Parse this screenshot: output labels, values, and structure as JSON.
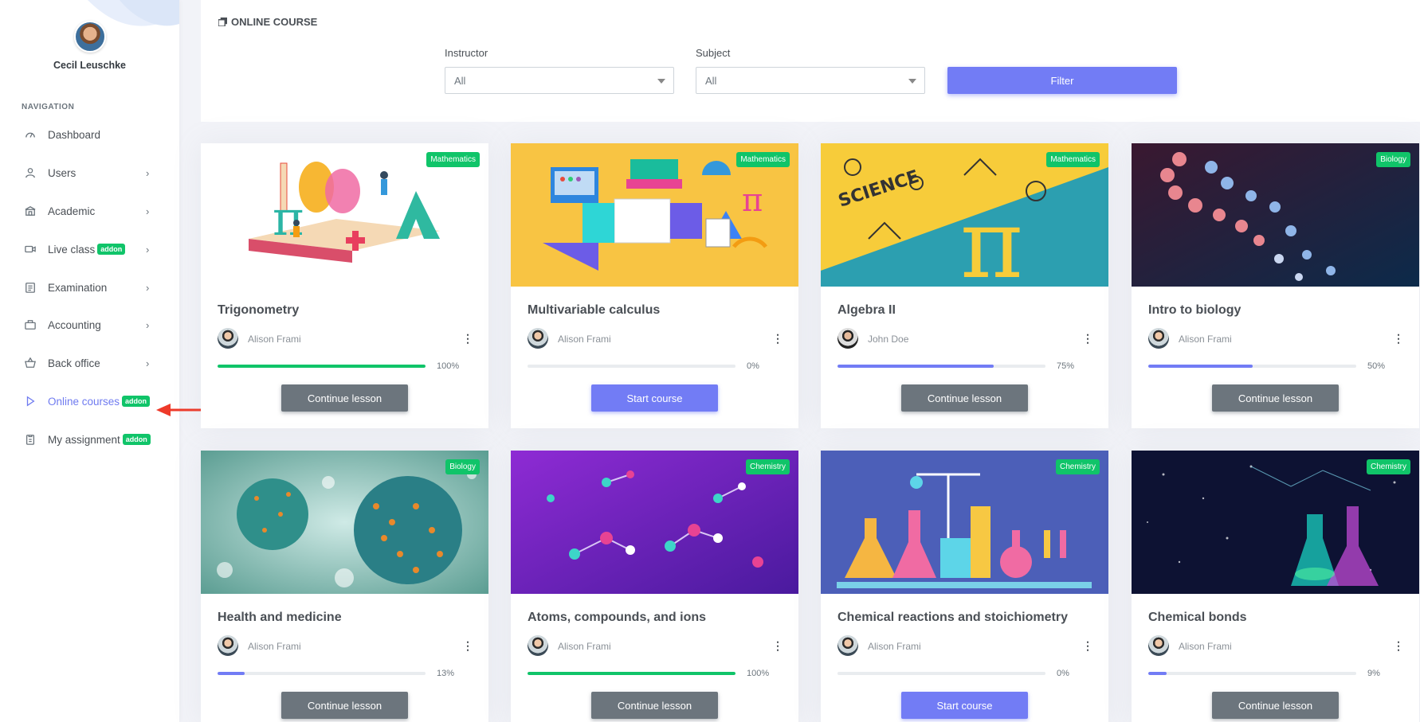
{
  "profile": {
    "name": "Cecil Leuschke"
  },
  "nav": {
    "title": "NAVIGATION",
    "items": [
      {
        "label": "Dashboard",
        "icon": "dashboard-gauge-icon",
        "chevron": false,
        "addon": ""
      },
      {
        "label": "Users",
        "icon": "user-icon",
        "chevron": true,
        "addon": ""
      },
      {
        "label": "Academic",
        "icon": "school-icon",
        "chevron": true,
        "addon": ""
      },
      {
        "label": "Live class",
        "icon": "video-icon",
        "chevron": true,
        "addon": "addon"
      },
      {
        "label": "Examination",
        "icon": "clipboard-icon",
        "chevron": true,
        "addon": ""
      },
      {
        "label": "Accounting",
        "icon": "briefcase-icon",
        "chevron": true,
        "addon": ""
      },
      {
        "label": "Back office",
        "icon": "basket-icon",
        "chevron": true,
        "addon": ""
      },
      {
        "label": "Online courses",
        "icon": "play-icon",
        "chevron": false,
        "addon": "addon",
        "active": true
      },
      {
        "label": "My assignment",
        "icon": "assignment-icon",
        "chevron": false,
        "addon": "addon"
      }
    ]
  },
  "header": {
    "title": "ONLINE COURSE",
    "instructor_label": "Instructor",
    "instructor_value": "All",
    "subject_label": "Subject",
    "subject_value": "All",
    "filter_label": "Filter"
  },
  "colors": {
    "accent": "#727cf5",
    "success": "#10c469",
    "secondary": "#6c757d"
  },
  "courses": [
    {
      "title": "Trigonometry",
      "category": "Mathematics",
      "instructor": "Alison Frami",
      "progress": 100,
      "progress_label": "100%",
      "action": "Continue lesson",
      "action_type": "continue",
      "bar_color": "#10c469"
    },
    {
      "title": "Multivariable calculus",
      "category": "Mathematics",
      "instructor": "Alison Frami",
      "progress": 0,
      "progress_label": "0%",
      "action": "Start course",
      "action_type": "start",
      "bar_color": "#727cf5"
    },
    {
      "title": "Algebra II",
      "category": "Mathematics",
      "instructor": "John Doe",
      "progress": 75,
      "progress_label": "75%",
      "action": "Continue lesson",
      "action_type": "continue",
      "bar_color": "#727cf5"
    },
    {
      "title": "Intro to biology",
      "category": "Biology",
      "instructor": "Alison Frami",
      "progress": 50,
      "progress_label": "50%",
      "action": "Continue lesson",
      "action_type": "continue",
      "bar_color": "#727cf5"
    },
    {
      "title": "Health and medicine",
      "category": "Biology",
      "instructor": "Alison Frami",
      "progress": 13,
      "progress_label": "13%",
      "action": "Continue lesson",
      "action_type": "continue",
      "bar_color": "#727cf5"
    },
    {
      "title": "Atoms, compounds, and ions",
      "category": "Chemistry",
      "instructor": "Alison Frami",
      "progress": 100,
      "progress_label": "100%",
      "action": "Continue lesson",
      "action_type": "continue",
      "bar_color": "#10c469"
    },
    {
      "title": "Chemical reactions and stoichiometry",
      "category": "Chemistry",
      "instructor": "Alison Frami",
      "progress": 0,
      "progress_label": "0%",
      "action": "Start course",
      "action_type": "start",
      "bar_color": "#727cf5"
    },
    {
      "title": "Chemical bonds",
      "category": "Chemistry",
      "instructor": "Alison Frami",
      "progress": 9,
      "progress_label": "9%",
      "action": "Continue lesson",
      "action_type": "continue",
      "bar_color": "#727cf5"
    }
  ]
}
